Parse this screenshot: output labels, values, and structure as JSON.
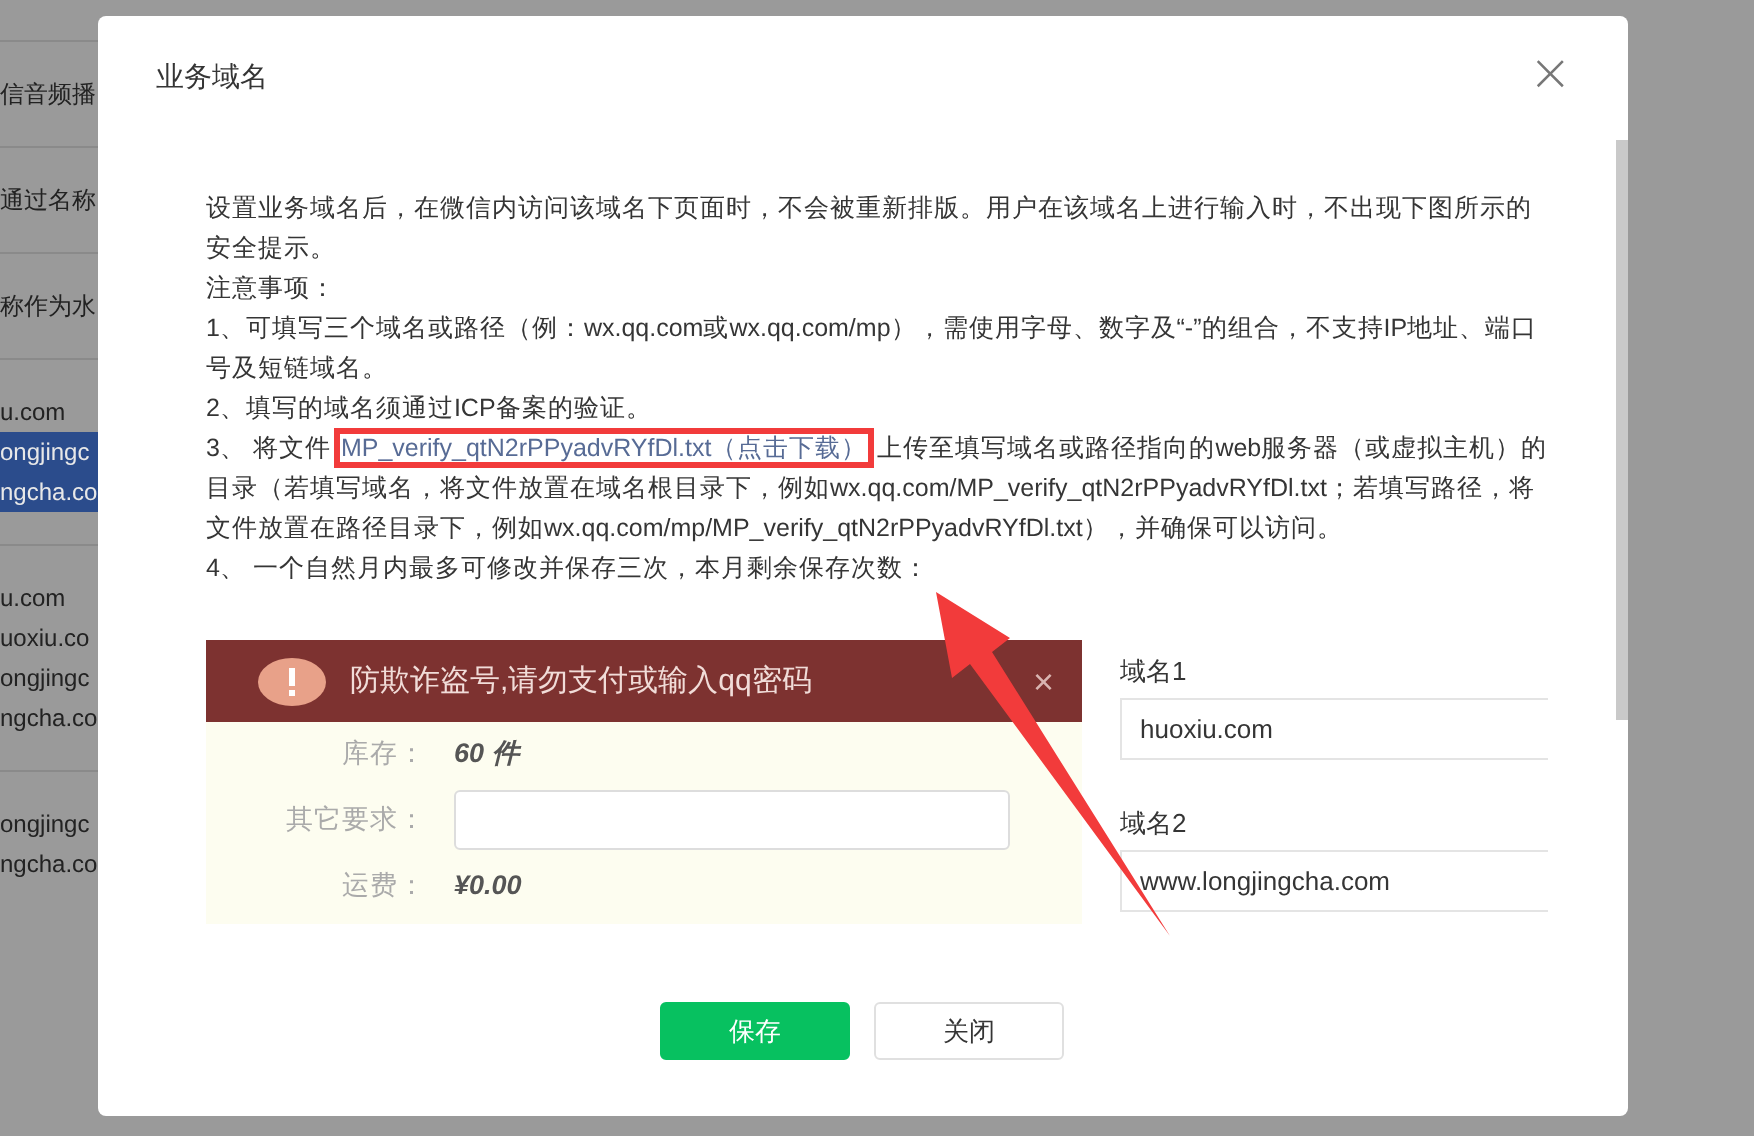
{
  "background_page": {
    "lines": [
      {
        "text": "信音频播",
        "selected": false,
        "group_start": true
      },
      {
        "text": "通过名称",
        "selected": false,
        "group_start": true
      },
      {
        "text": "称作为水",
        "selected": false,
        "group_start": true
      },
      {
        "text": "u.com",
        "selected": false,
        "group_start": true
      },
      {
        "text": "ongjingc",
        "selected": true,
        "group_start": false
      },
      {
        "text": "ngcha.co",
        "selected": true,
        "group_start": false
      },
      {
        "text": "u.com",
        "selected": false,
        "group_start": true
      },
      {
        "text": "uoxiu.co",
        "selected": false,
        "group_start": false
      },
      {
        "text": "ongjingc",
        "selected": false,
        "group_start": false
      },
      {
        "text": "ngcha.co",
        "selected": false,
        "group_start": false
      },
      {
        "text": "ongjingc",
        "selected": false,
        "group_start": true
      },
      {
        "text": "ngcha.co",
        "selected": false,
        "group_start": false
      }
    ]
  },
  "dialog": {
    "title": "业务域名",
    "close": "×",
    "intro": "设置业务域名后，在微信内访问该域名下页面时，不会被重新排版。用户在该域名上进行输入时，不出现下图所示的安全提示。",
    "notes_heading": "注意事项：",
    "notes": [
      {
        "kind": "plain",
        "text": "1、可填写三个域名或路径（例：wx.qq.com或wx.qq.com/mp），需使用字母、数字及“-”的组合，不支持IP地址、端口号及短链域名。"
      },
      {
        "kind": "plain",
        "text": "2、填写的域名须通过ICP备案的验证。"
      },
      {
        "kind": "download",
        "before": "3、 将文件",
        "link": "MP_verify_qtN2rPPyadvRYfDl.txt（点击下载）",
        "after": "上传至填写域名或路径指向的web服务器（或虚拟主机）的目录（若填写域名，将文件放置在域名根目录下，例如wx.qq.com/MP_verify_qtN2rPPyadvRYfDl.txt；若填写路径，将文件放置在路径目录下，例如wx.qq.com/mp/MP_verify_qtN2rPPyadvRYfDl.txt），并确保可以访问。"
      },
      {
        "kind": "plain",
        "text": "4、 一个自然月内最多可修改并保存三次，本月剩余保存次数："
      }
    ],
    "example_screenshot": {
      "warning": "防欺诈盗号,请勿支付或输入qq密码",
      "warning_close": "×",
      "stock_label": "库存：",
      "stock_value": "60 件",
      "other_label": "其它要求：",
      "shipping_label": "运费：",
      "shipping_value": "¥0.00"
    },
    "domains": [
      {
        "label": "域名1",
        "value": "huoxiu.com"
      },
      {
        "label": "域名2",
        "value": "www.longjingcha.com"
      }
    ],
    "buttons": [
      {
        "label": "保存",
        "kind": "primary"
      },
      {
        "label": "关闭",
        "kind": "default"
      }
    ]
  }
}
